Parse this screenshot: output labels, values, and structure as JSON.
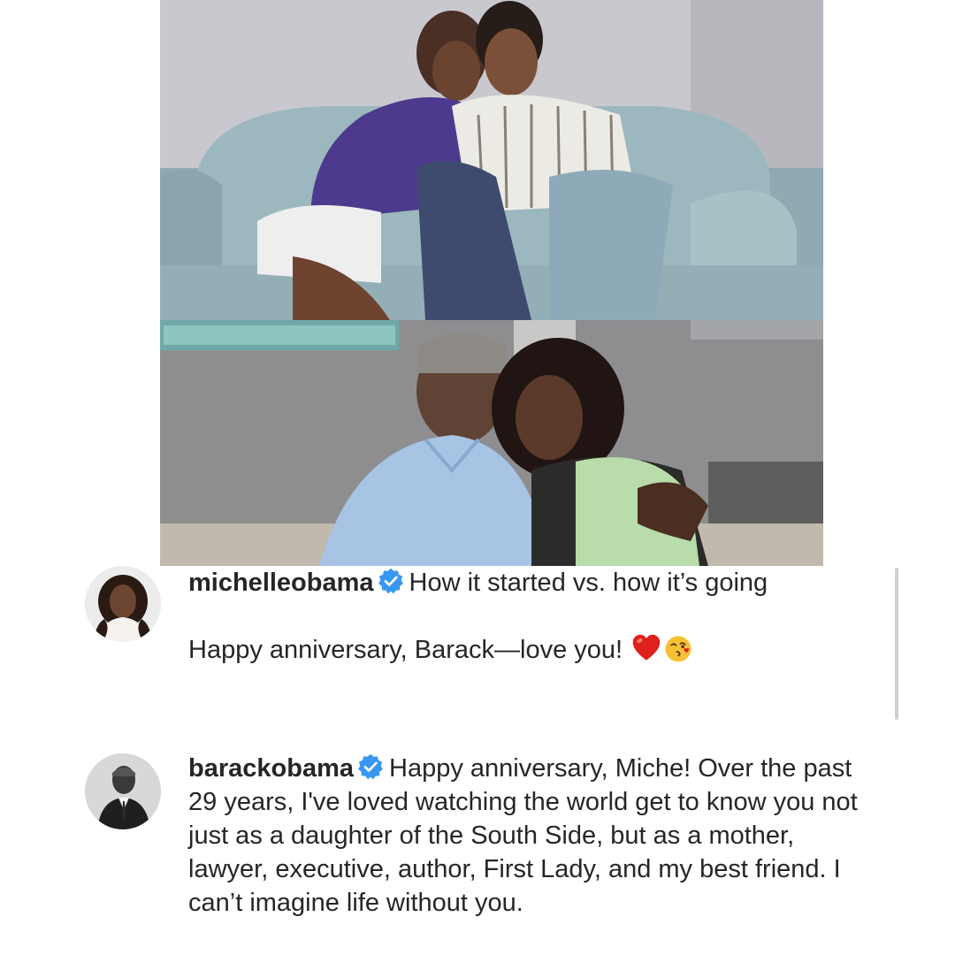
{
  "posts": [
    {
      "username": "michelleobama",
      "verified": true,
      "caption_line1": "How it started vs. how it’s going",
      "caption_line2": "Happy anniversary, Barack—love you!",
      "emojis": [
        "red-heart-emoji",
        "face-blowing-kiss-emoji"
      ]
    },
    {
      "username": "barackobama",
      "verified": true,
      "caption": "Happy anniversary, Miche! Over the past 29 years, I've loved watching the world get to know you not just as a daughter of the South Side, but as a mother, lawyer, executive, author, First Lady, and my best friend. I can’t imagine life without you."
    }
  ],
  "colors": {
    "verified_blue": "#3897f0",
    "text": "#262626",
    "heart_red": "#e0201c",
    "emoji_yellow": "#f7c136"
  }
}
